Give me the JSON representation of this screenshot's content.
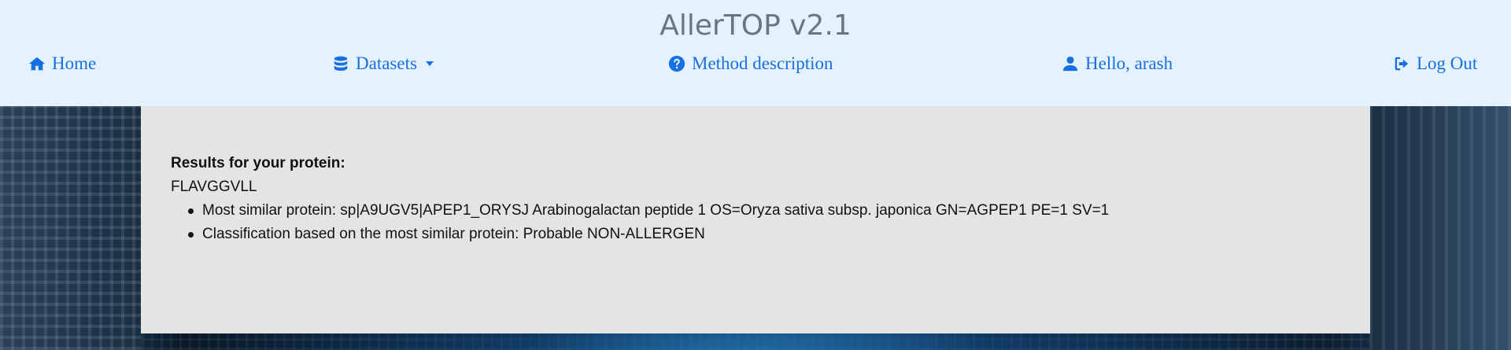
{
  "site": {
    "title": "AllerTOP v2.1"
  },
  "nav": {
    "home": "Home",
    "datasets": "Datasets",
    "method": "Method description",
    "user": "Hello, arash",
    "logout": "Log Out"
  },
  "icons": {
    "home": "home-icon",
    "datasets": "database-icon",
    "method": "question-circle-icon",
    "user": "user-icon",
    "logout": "sign-out-icon"
  },
  "colors": {
    "link": "#1a6fe0",
    "header_bg": "#e3f2fd",
    "panel_bg": "#e4e4e4",
    "title": "#6c757d"
  },
  "result": {
    "heading": "Results for your protein:",
    "sequence": "FLAVGGVLL",
    "items": [
      "Most similar protein: sp|A9UGV5|APEP1_ORYSJ Arabinogalactan peptide 1 OS=Oryza sativa subsp. japonica GN=AGPEP1 PE=1 SV=1",
      "Classification based on the most similar protein: Probable NON-ALLERGEN"
    ]
  }
}
